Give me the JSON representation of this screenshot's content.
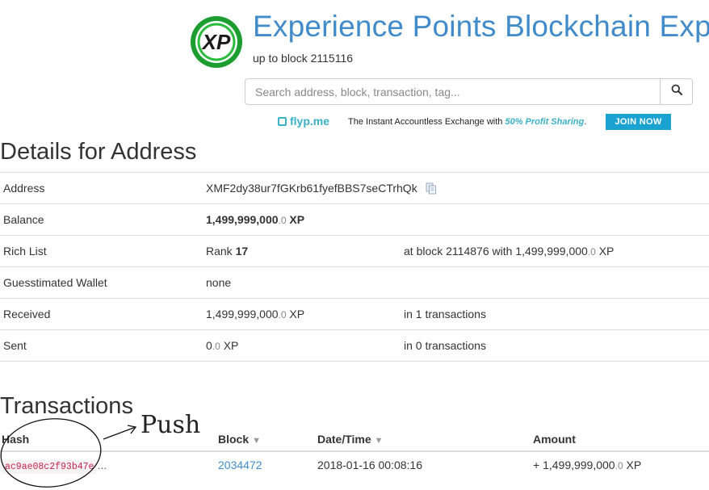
{
  "header": {
    "logo_text": "XP",
    "title": "Experience Points Blockchain Explo",
    "subtitle": "up to block 2115116"
  },
  "search": {
    "placeholder": "Search address, block, transaction, tag..."
  },
  "ad": {
    "brand": "flyp.me",
    "text_before": "The Instant Accountless Exchange with ",
    "text_em": "50% Profit Sharing",
    "text_after": ".",
    "button": "JOIN NOW"
  },
  "details": {
    "heading": "Details for Address",
    "rows": [
      {
        "label": "Address",
        "value": "XMF2dy38ur7fGKrb61fyefBBS7seCTrhQk"
      },
      {
        "label": "Balance",
        "value_int": "1,499,999,000",
        "value_dec": ".0",
        "unit": " XP"
      },
      {
        "label": "Rich List",
        "rank_prefix": "Rank ",
        "rank": "17",
        "extra_pre": "at block 2114876 with 1,499,999,000",
        "extra_dec": ".0",
        "extra_unit": " XP"
      },
      {
        "label": "Guesstimated Wallet",
        "value": "none"
      },
      {
        "label": "Received",
        "value_int": "1,499,999,000",
        "value_dec": ".0",
        "unit": " XP",
        "extra": "in 1 transactions"
      },
      {
        "label": "Sent",
        "value_int": "0",
        "value_dec": ".0",
        "unit": " XP",
        "extra": "in 0 transactions"
      }
    ]
  },
  "transactions": {
    "heading": "Transactions",
    "columns": {
      "hash": "Hash",
      "block": "Block",
      "datetime": "Date/Time",
      "amount": "Amount"
    },
    "sort_glyph": "▼",
    "rows": [
      {
        "hash": "ac9ae08c2f93b47e",
        "ellipsis": "…",
        "block": "2034472",
        "datetime": "2018-01-16 00:08:16",
        "amount_int": "+ 1,499,999,000",
        "amount_dec": ".0",
        "unit": " XP"
      }
    ]
  },
  "annotation": {
    "text": "Push"
  },
  "colors": {
    "link": "#428bca",
    "accent": "#3ab0c8",
    "join_button": "#1aa3d1",
    "code_text": "#c7254e"
  },
  "icons": [
    "xp-logo-icon",
    "search-icon",
    "flyp-logo-icon",
    "copy-icon",
    "sort-down-icon"
  ]
}
